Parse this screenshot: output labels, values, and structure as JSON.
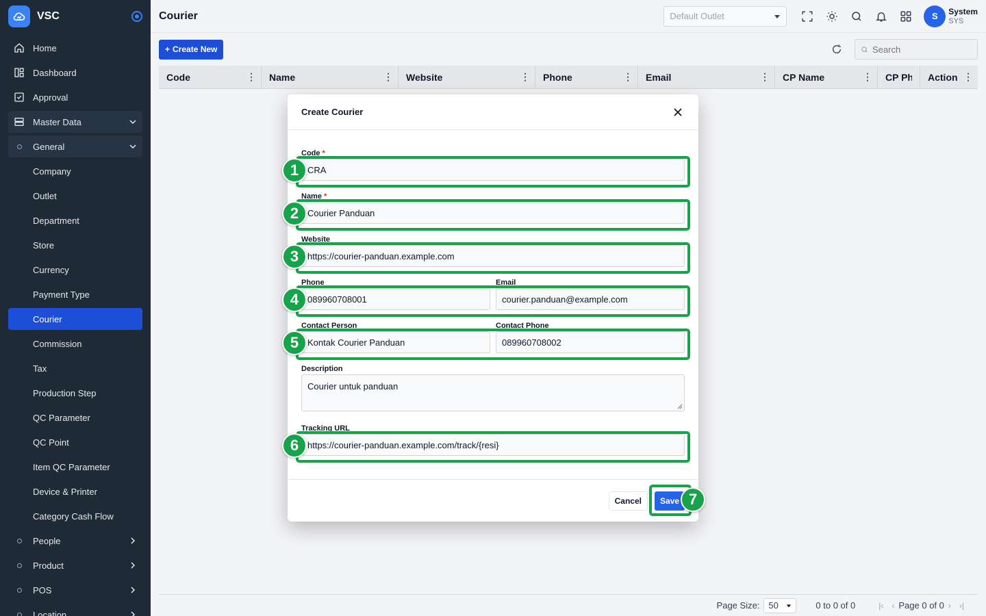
{
  "brand": {
    "name": "VSC"
  },
  "sidebar": {
    "items": [
      {
        "label": "Home",
        "icon": "home-icon"
      },
      {
        "label": "Dashboard",
        "icon": "dashboard-icon"
      },
      {
        "label": "Approval",
        "icon": "approval-icon"
      },
      {
        "label": "Master Data",
        "icon": "database-icon"
      },
      {
        "label": "General",
        "icon": "circle-icon"
      },
      {
        "label": "Company"
      },
      {
        "label": "Outlet"
      },
      {
        "label": "Department"
      },
      {
        "label": "Store"
      },
      {
        "label": "Currency"
      },
      {
        "label": "Payment Type"
      },
      {
        "label": "Courier"
      },
      {
        "label": "Commission"
      },
      {
        "label": "Tax"
      },
      {
        "label": "Production Step"
      },
      {
        "label": "QC Parameter"
      },
      {
        "label": "QC Point"
      },
      {
        "label": "Item QC Parameter"
      },
      {
        "label": "Device & Printer"
      },
      {
        "label": "Category Cash Flow"
      },
      {
        "label": "People"
      },
      {
        "label": "Product"
      },
      {
        "label": "POS"
      },
      {
        "label": "Location"
      }
    ]
  },
  "header": {
    "title": "Courier",
    "outlet_placeholder": "Default Outlet",
    "user_name": "System",
    "user_code": "SYS",
    "avatar_initial": "S"
  },
  "toolbar": {
    "create_label": "Create New",
    "search_placeholder": "Search"
  },
  "grid": {
    "columns": [
      "Code",
      "Name",
      "Website",
      "Phone",
      "Email",
      "CP Name",
      "CP Phone",
      "Action"
    ],
    "page_size_label": "Page Size:",
    "page_size": "50",
    "range_text": "0 to 0 of 0",
    "page_text": "Page 0 of 0"
  },
  "modal": {
    "title": "Create Courier",
    "fields": {
      "code": {
        "label": "Code",
        "value": "CRA"
      },
      "name": {
        "label": "Name",
        "value": "Courier Panduan"
      },
      "website": {
        "label": "Website",
        "value": "https://courier-panduan.example.com"
      },
      "phone": {
        "label": "Phone",
        "value": "089960708001"
      },
      "email": {
        "label": "Email",
        "value": "courier.panduan@example.com"
      },
      "contact_person": {
        "label": "Contact Person",
        "value": "Kontak Courier Panduan"
      },
      "contact_phone": {
        "label": "Contact Phone",
        "value": "089960708002"
      },
      "description": {
        "label": "Description",
        "value": "Courier untuk panduan"
      },
      "tracking_url": {
        "label": "Tracking URL",
        "value": "https://courier-panduan.example.com/track/{resi}"
      }
    },
    "cancel_label": "Cancel",
    "save_label": "Save"
  },
  "annotations": [
    "1",
    "2",
    "3",
    "4",
    "5",
    "6",
    "7"
  ],
  "colors": {
    "accent": "#1d4ed8",
    "sidebar": "#1f2a37",
    "highlight": "#16a34a"
  }
}
